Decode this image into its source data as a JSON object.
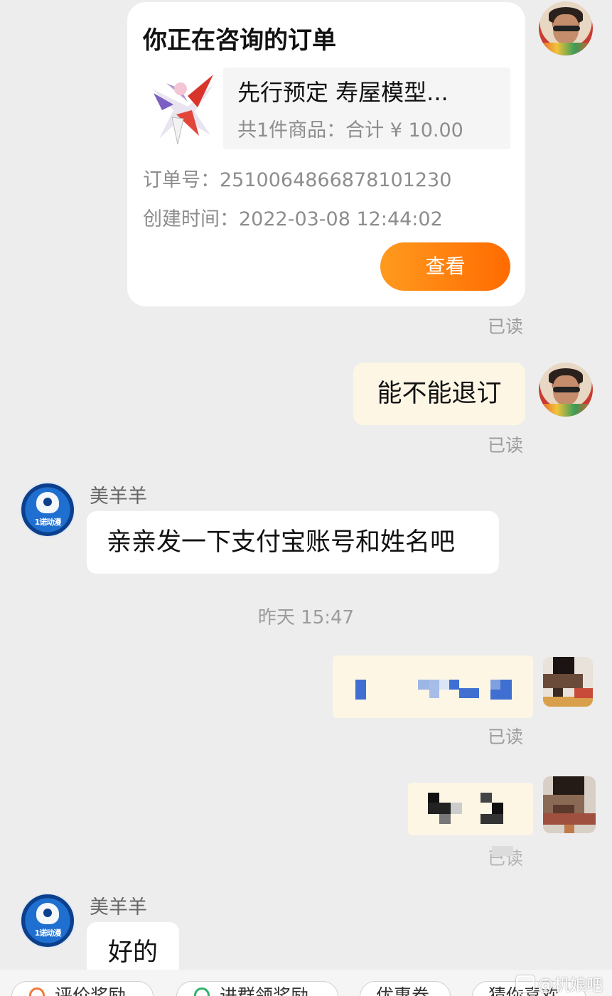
{
  "order_card": {
    "title": "你正在咨询的订单",
    "product_name": "先行预定 寿屋模型...",
    "summary": "共1件商品：合计 ¥ 10.00",
    "order_no": "订单号：2510064866878101230",
    "created": "创建时间：2022-03-08 12:44:02",
    "view_label": "查看"
  },
  "messages": {
    "read_label": "已读",
    "outgoing_1": "能不能退订",
    "sender_name": "美羊羊",
    "incoming_1": "亲亲发一下支付宝账号和姓名吧",
    "timestamp": "昨天 15:47",
    "incoming_2": "好的"
  },
  "quick_replies": [
    {
      "label": "评价奖励",
      "icon": "gift-icon",
      "color": "#f07a3a"
    },
    {
      "label": "进群领奖励",
      "icon": "group-icon",
      "color": "#2fb36b"
    },
    {
      "label": "优惠券",
      "icon": "coupon-icon",
      "color": "#333333"
    },
    {
      "label": "猜你喜欢",
      "icon": "heart-icon",
      "color": "#333333"
    }
  ],
  "watermark": "@机娘吧",
  "colors": {
    "accent_orange": "#ff7a00",
    "outgoing_bubble": "#fdf6e5",
    "background": "#ededed"
  }
}
